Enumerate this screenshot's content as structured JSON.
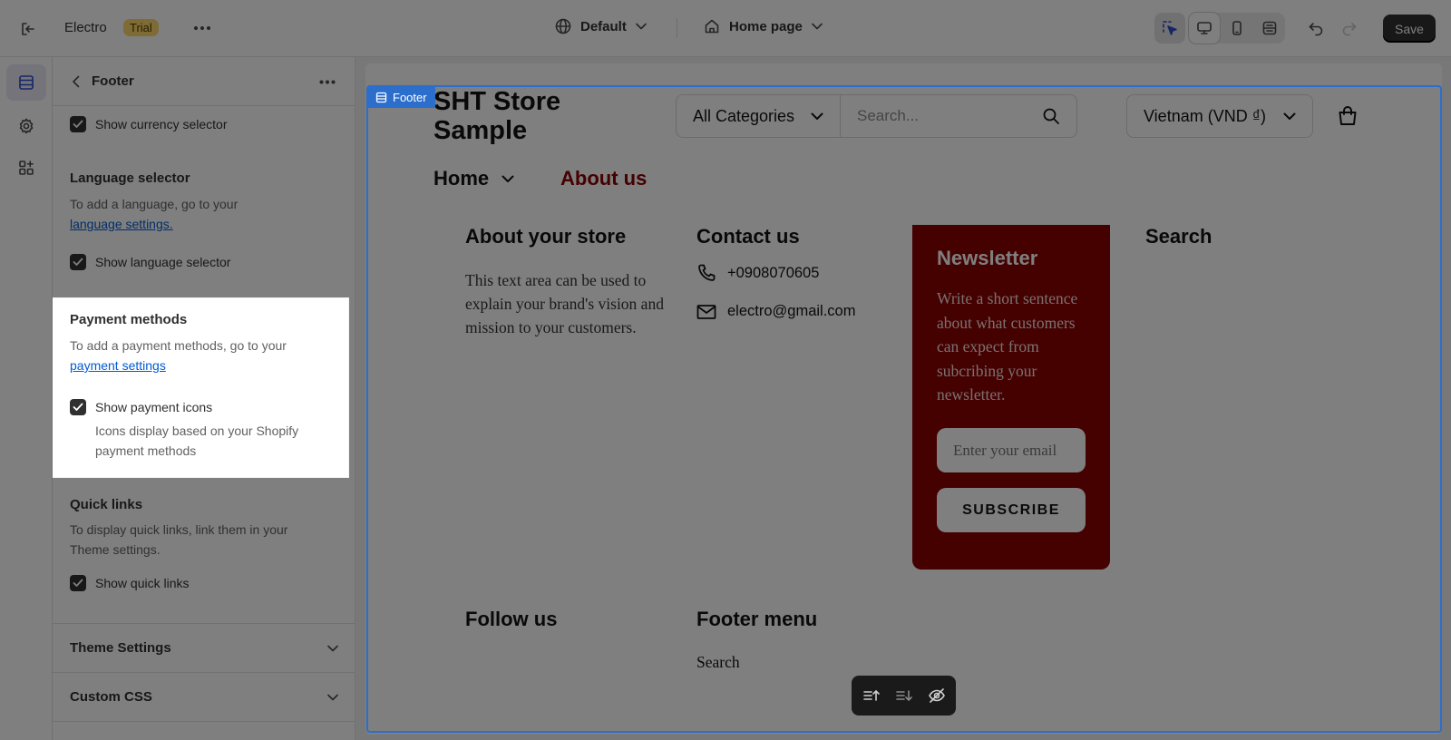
{
  "topbar": {
    "store_name": "Electro",
    "badge": "Trial",
    "theme": "Default",
    "page": "Home page",
    "save_label": "Save"
  },
  "sidebar": {
    "title": "Footer",
    "currency": {
      "checkbox": "Show currency selector"
    },
    "language": {
      "heading": "Language selector",
      "text": "To add a language, go to your",
      "link": "language settings.",
      "checkbox": "Show language selector"
    },
    "payment": {
      "heading": "Payment methods",
      "text": "To add a payment methods, go to your",
      "link": "payment settings",
      "checkbox": "Show payment icons",
      "help": "Icons display based on your Shopify payment methods"
    },
    "quick_links": {
      "heading": "Quick links",
      "text": "To display quick links, link them in your Theme settings.",
      "checkbox": "Show quick links"
    },
    "theme_settings": "Theme Settings",
    "custom_css": "Custom CSS"
  },
  "preview": {
    "tag": "Footer",
    "store_title": "SHT Store Sample",
    "category_select": "All Categories",
    "search_placeholder": "Search...",
    "country_select": "Vietnam (VND ₫)",
    "nav_home": "Home",
    "nav_about": "About us",
    "footer": {
      "about_heading": "About your store",
      "about_text": "This text area can be used to explain your brand's vision and mission to your customers.",
      "contact_heading": "Contact us",
      "phone": "+0908070605",
      "email": "electro@gmail.com",
      "newsletter_heading": "Newsletter",
      "newsletter_text": "Write a short sentence about what customers can expect from subcribing your newsletter.",
      "email_placeholder": "Enter your email",
      "subscribe_label": "SUBSCRIBE",
      "search_heading": "Search",
      "follow_heading": "Follow us",
      "menu_heading": "Footer menu",
      "menu_item": "Search"
    }
  },
  "colors": {
    "accent": "#2c6ecb",
    "brand": "#8b0000",
    "badge": "#ffd66b"
  }
}
